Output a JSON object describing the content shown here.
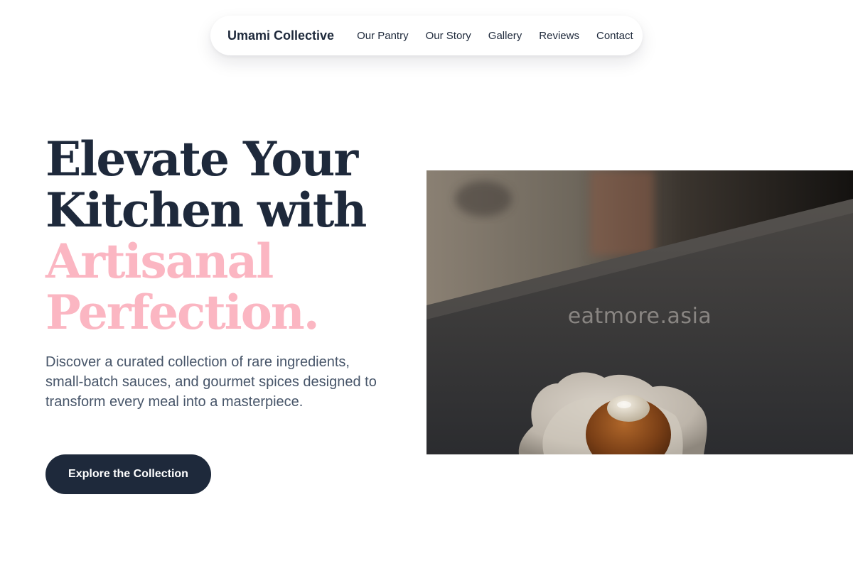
{
  "nav": {
    "brand": "Umami Collective",
    "links": [
      "Our Pantry",
      "Our Story",
      "Gallery",
      "Reviews",
      "Contact"
    ]
  },
  "hero": {
    "headline_dark": [
      "Elevate Your",
      "Kitchen with"
    ],
    "headline_accent": [
      "Artisanal",
      "Perfection."
    ],
    "description": "Discover a curated collection of rare ingredients, small-batch sauces, and gourmet spices designed to transform every meal into a masterpiece.",
    "cta_label": "Explore the Collection",
    "image_watermark": "eatmore.asia"
  },
  "colors": {
    "primary": "#1e293b",
    "accent_pink": "#fbb6c2",
    "body_text": "#475569"
  }
}
